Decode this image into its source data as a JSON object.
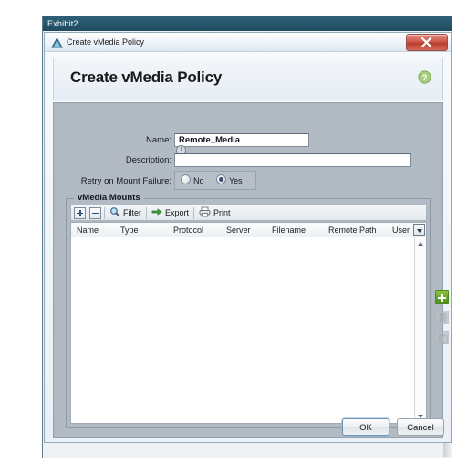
{
  "outer_window": {
    "title": "Exhibit2"
  },
  "dialog": {
    "titlebar_text": "Create vMedia Policy",
    "title_icon": "warning-triangle-icon",
    "close_icon": "close-icon",
    "header_title": "Create vMedia Policy",
    "help_icon": "help-icon"
  },
  "form": {
    "name": {
      "label": "Name:",
      "value": "Remote_Media",
      "placeholder": ""
    },
    "description": {
      "label": "Description:",
      "value": "",
      "placeholder": ""
    },
    "retry_on_mount_failure": {
      "label": "Retry on Mount Failure:",
      "options": [
        {
          "label": "No",
          "selected": false
        },
        {
          "label": "Yes",
          "selected": true
        }
      ]
    }
  },
  "group": {
    "title": "vMedia Mounts",
    "toolbar": [
      {
        "name": "add-row-button",
        "label": "",
        "icon": "plus-square-icon"
      },
      {
        "name": "remove-row-button",
        "label": "",
        "icon": "minus-square-icon"
      },
      {
        "name": "filter-button",
        "label": "Filter",
        "icon": "magnifier-icon"
      },
      {
        "name": "export-button",
        "label": "Export",
        "icon": "export-arrow-icon"
      },
      {
        "name": "print-button",
        "label": "Print",
        "icon": "printer-icon"
      }
    ],
    "table": {
      "columns": [
        "Name",
        "Type",
        "Protocol",
        "Server",
        "Filename",
        "Remote Path",
        "User"
      ],
      "rows": [],
      "column_picker_icon": "column-chooser-icon"
    },
    "side_actions": [
      {
        "name": "add-button",
        "icon": "plus-icon",
        "enabled": true
      },
      {
        "name": "delete-button",
        "icon": "trash-icon",
        "enabled": false
      },
      {
        "name": "copy-button",
        "icon": "copy-icon",
        "enabled": false
      }
    ]
  },
  "footer": {
    "ok_label": "OK",
    "cancel_label": "Cancel"
  },
  "colors": {
    "accent_blue": "#28566d",
    "body_grey": "#b2bac3",
    "add_green": "#64a726",
    "close_red": "#cf5a4c"
  }
}
